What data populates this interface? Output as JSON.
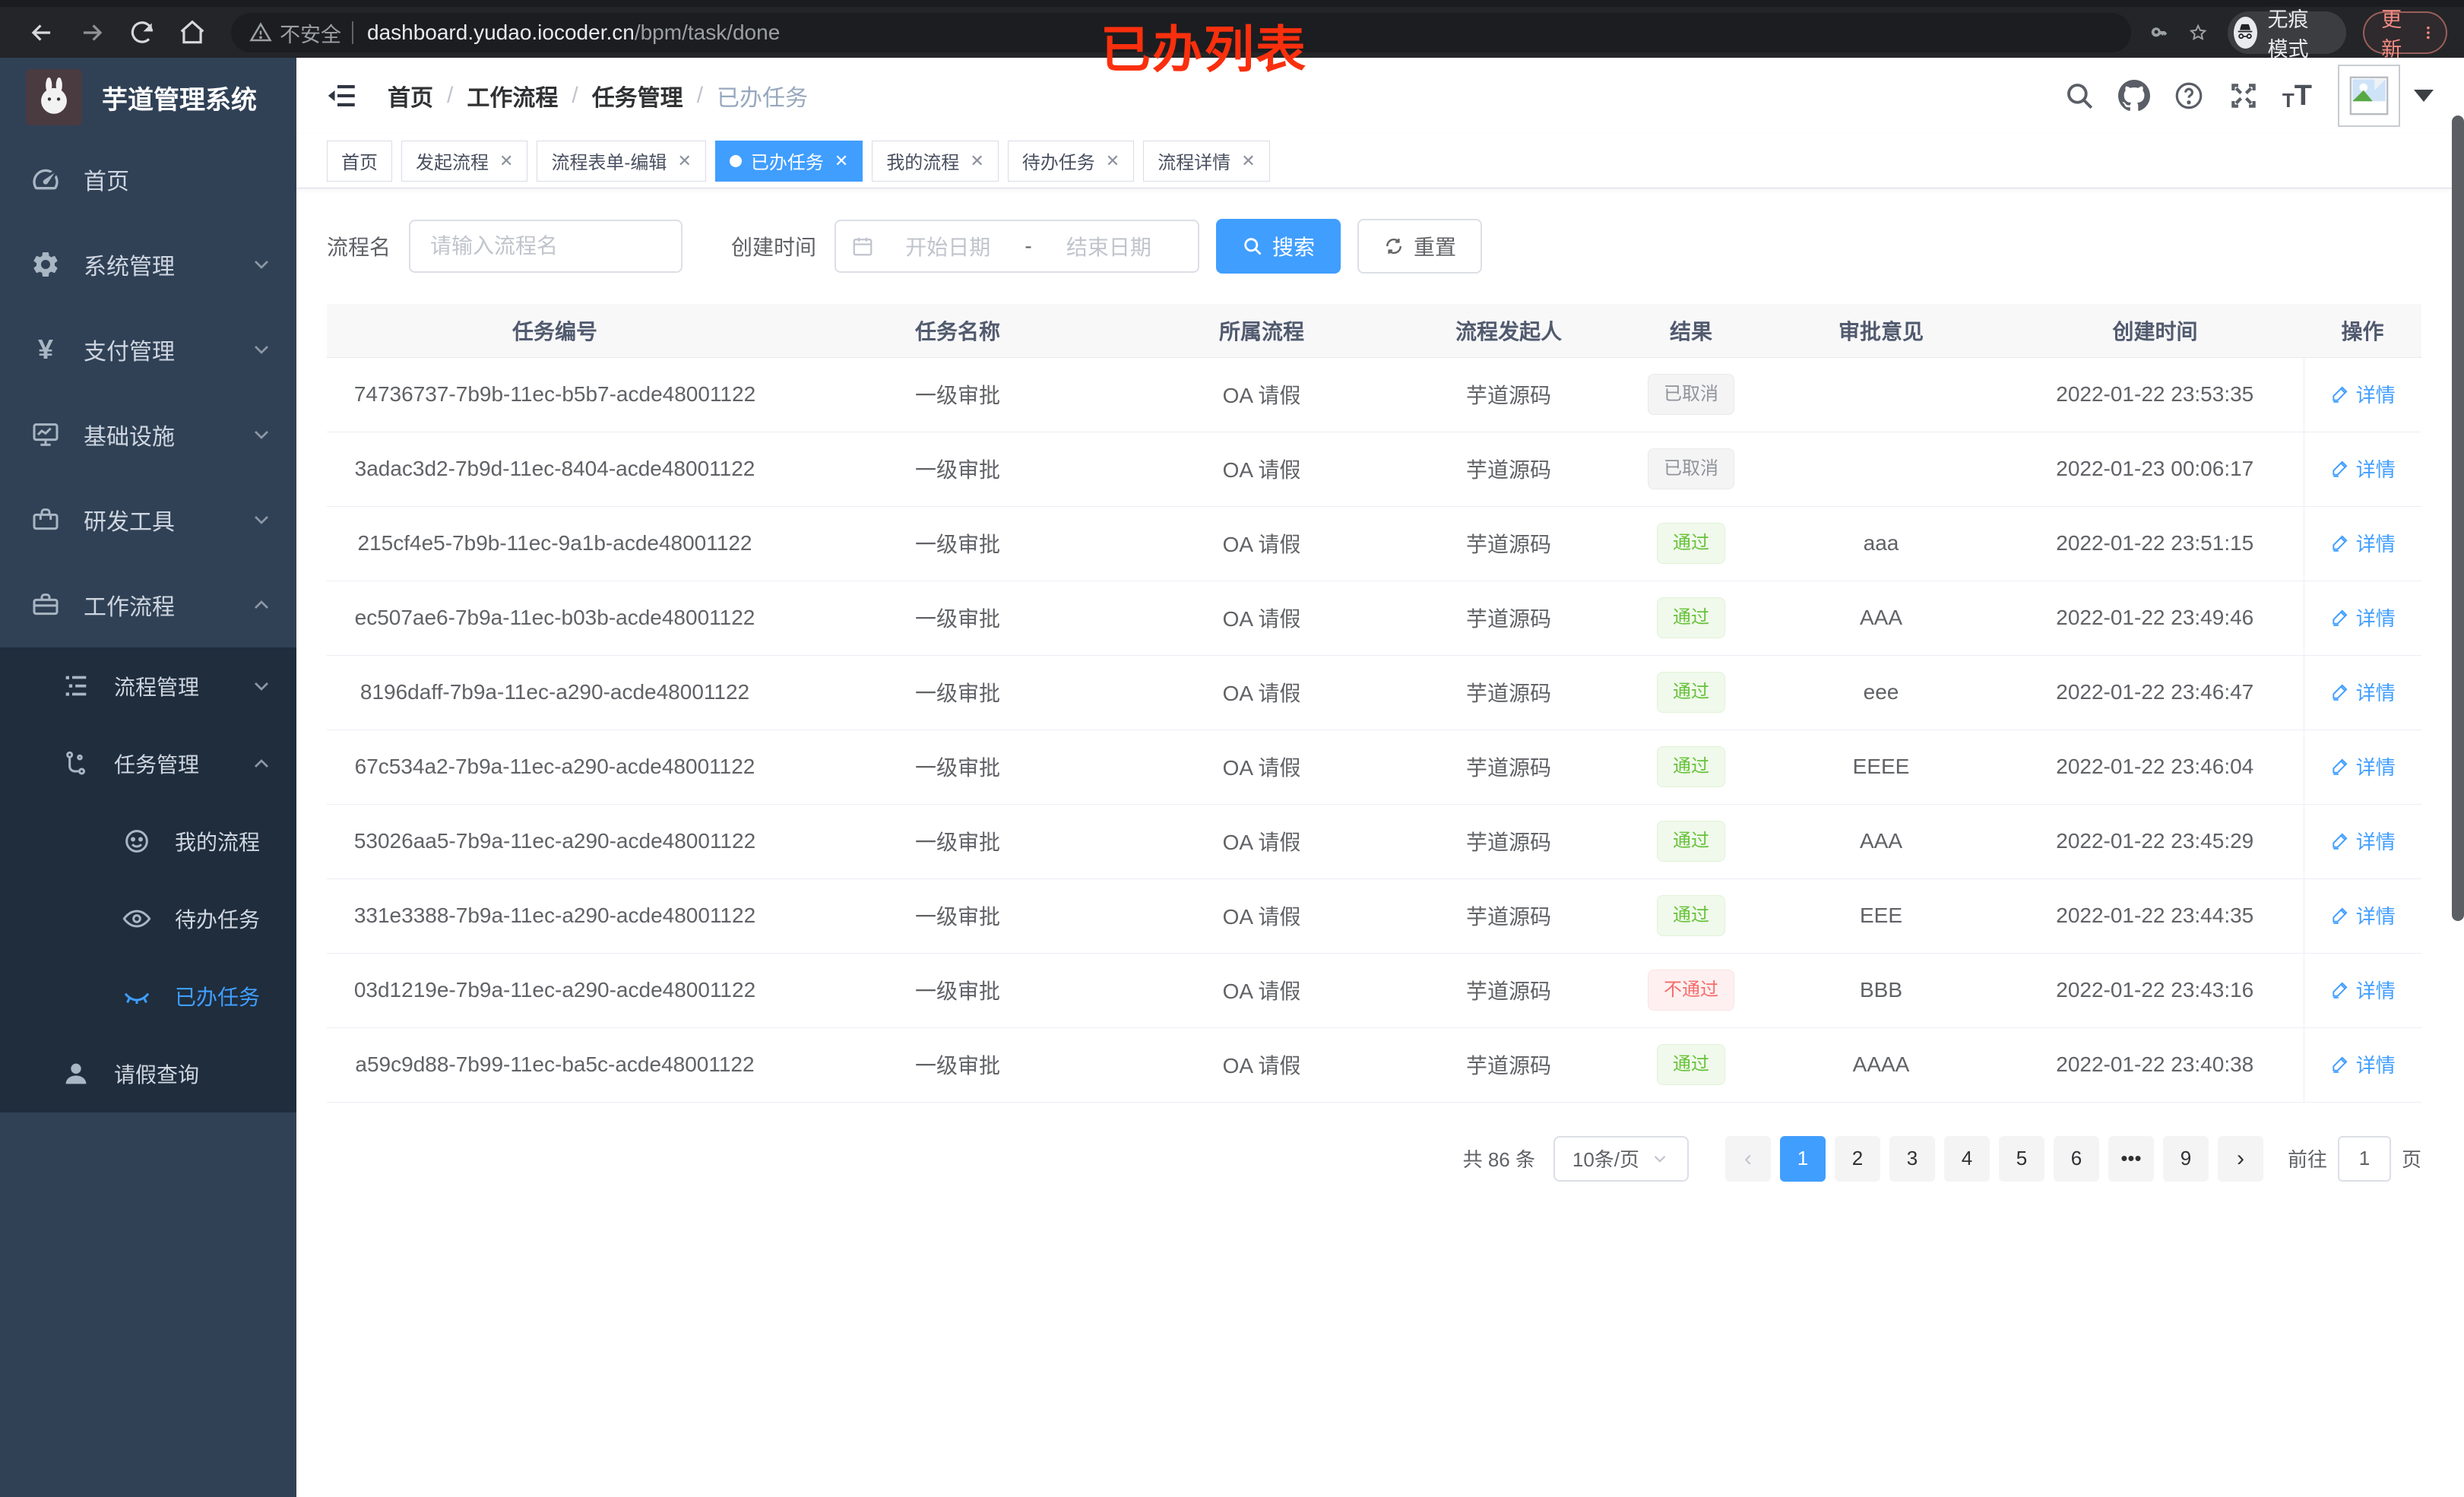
{
  "browser": {
    "security_warning": "不安全",
    "url_host": "dashboard.yudao.iocoder.cn",
    "url_path": "/bpm/task/done",
    "incognito_label": "无痕模式",
    "update_label": "更新"
  },
  "annotation": {
    "title": "已办列表",
    "color": "#fa2f0d"
  },
  "sidebar": {
    "app_title": "芋道管理系统",
    "items": [
      {
        "label": "首页"
      },
      {
        "label": "系统管理"
      },
      {
        "label": "支付管理"
      },
      {
        "label": "基础设施"
      },
      {
        "label": "研发工具"
      },
      {
        "label": "工作流程"
      }
    ],
    "submenu": {
      "process_mgmt": "流程管理",
      "task_mgmt": "任务管理",
      "my_process": "我的流程",
      "todo_tasks": "待办任务",
      "done_tasks": "已办任务",
      "leave_query": "请假查询"
    }
  },
  "breadcrumb": {
    "items": [
      "首页",
      "工作流程",
      "任务管理",
      "已办任务"
    ],
    "separator": "/"
  },
  "tabs": [
    {
      "label": "首页",
      "closable": false,
      "cls": "",
      "dot": false
    },
    {
      "label": "发起流程",
      "closable": true,
      "cls": "",
      "dot": false
    },
    {
      "label": "流程表单-编辑",
      "closable": true,
      "cls": "",
      "dot": false
    },
    {
      "label": "已办任务",
      "closable": true,
      "cls": "active",
      "dot": true
    },
    {
      "label": "我的流程",
      "closable": true,
      "cls": "",
      "dot": false
    },
    {
      "label": "待办任务",
      "closable": true,
      "cls": "",
      "dot": false
    },
    {
      "label": "流程详情",
      "closable": true,
      "cls": "",
      "dot": false
    }
  ],
  "filters": {
    "name_label": "流程名",
    "name_placeholder": "请输入流程名",
    "time_label": "创建时间",
    "start_placeholder": "开始日期",
    "range_separator": "-",
    "end_placeholder": "结束日期",
    "search_label": "搜索",
    "reset_label": "重置"
  },
  "table": {
    "columns": [
      "任务编号",
      "任务名称",
      "所属流程",
      "流程发起人",
      "结果",
      "审批意见",
      "创建时间",
      "操作"
    ],
    "rows": [
      {
        "id": "74736737-7b9b-11ec-b5b7-acde48001122",
        "name": "一级审批",
        "process": "OA 请假",
        "starter": "芋道源码",
        "result": "已取消",
        "result_cls": "tag-info",
        "comment": "",
        "time": "2022-01-22 23:53:35",
        "action": "详情"
      },
      {
        "id": "3adac3d2-7b9d-11ec-8404-acde48001122",
        "name": "一级审批",
        "process": "OA 请假",
        "starter": "芋道源码",
        "result": "已取消",
        "result_cls": "tag-info",
        "comment": "",
        "time": "2022-01-23 00:06:17",
        "action": "详情"
      },
      {
        "id": "215cf4e5-7b9b-11ec-9a1b-acde48001122",
        "name": "一级审批",
        "process": "OA 请假",
        "starter": "芋道源码",
        "result": "通过",
        "result_cls": "tag-success",
        "comment": "aaa",
        "time": "2022-01-22 23:51:15",
        "action": "详情"
      },
      {
        "id": "ec507ae6-7b9a-11ec-b03b-acde48001122",
        "name": "一级审批",
        "process": "OA 请假",
        "starter": "芋道源码",
        "result": "通过",
        "result_cls": "tag-success",
        "comment": "AAA",
        "time": "2022-01-22 23:49:46",
        "action": "详情"
      },
      {
        "id": "8196daff-7b9a-11ec-a290-acde48001122",
        "name": "一级审批",
        "process": "OA 请假",
        "starter": "芋道源码",
        "result": "通过",
        "result_cls": "tag-success",
        "comment": "eee",
        "time": "2022-01-22 23:46:47",
        "action": "详情"
      },
      {
        "id": "67c534a2-7b9a-11ec-a290-acde48001122",
        "name": "一级审批",
        "process": "OA 请假",
        "starter": "芋道源码",
        "result": "通过",
        "result_cls": "tag-success",
        "comment": "EEEE",
        "time": "2022-01-22 23:46:04",
        "action": "详情"
      },
      {
        "id": "53026aa5-7b9a-11ec-a290-acde48001122",
        "name": "一级审批",
        "process": "OA 请假",
        "starter": "芋道源码",
        "result": "通过",
        "result_cls": "tag-success",
        "comment": "AAA",
        "time": "2022-01-22 23:45:29",
        "action": "详情"
      },
      {
        "id": "331e3388-7b9a-11ec-a290-acde48001122",
        "name": "一级审批",
        "process": "OA 请假",
        "starter": "芋道源码",
        "result": "通过",
        "result_cls": "tag-success",
        "comment": "EEE",
        "time": "2022-01-22 23:44:35",
        "action": "详情"
      },
      {
        "id": "03d1219e-7b9a-11ec-a290-acde48001122",
        "name": "一级审批",
        "process": "OA 请假",
        "starter": "芋道源码",
        "result": "不通过",
        "result_cls": "tag-danger",
        "comment": "BBB",
        "time": "2022-01-22 23:43:16",
        "action": "详情"
      },
      {
        "id": "a59c9d88-7b99-11ec-ba5c-acde48001122",
        "name": "一级审批",
        "process": "OA 请假",
        "starter": "芋道源码",
        "result": "通过",
        "result_cls": "tag-success",
        "comment": "AAAA",
        "time": "2022-01-22 23:40:38",
        "action": "详情"
      }
    ]
  },
  "pagination": {
    "total": "共 86 条",
    "size": "10条/页",
    "prev": "‹",
    "next": "›",
    "pages": [
      {
        "label": "1",
        "cls": "active"
      },
      {
        "label": "2",
        "cls": ""
      },
      {
        "label": "3",
        "cls": ""
      },
      {
        "label": "4",
        "cls": ""
      },
      {
        "label": "5",
        "cls": ""
      },
      {
        "label": "6",
        "cls": ""
      },
      {
        "label": "•••",
        "cls": "ell"
      },
      {
        "label": "9",
        "cls": ""
      }
    ],
    "goto_label": "前往",
    "goto_value": "1",
    "unit_label": "页"
  }
}
